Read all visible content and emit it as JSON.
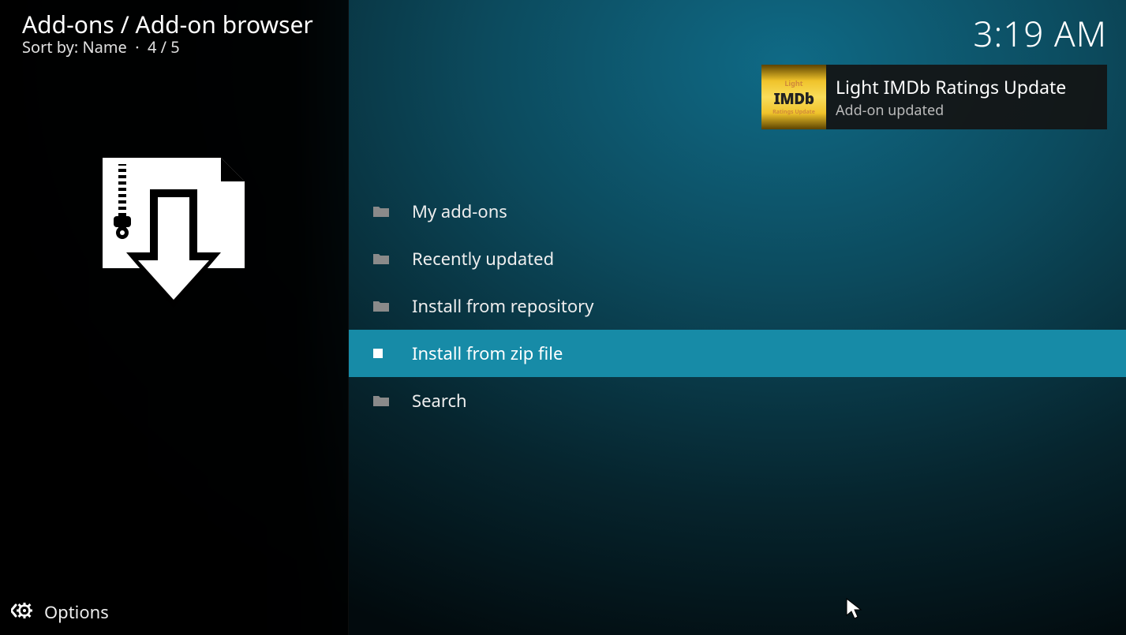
{
  "header": {
    "breadcrumb": "Add-ons / Add-on browser",
    "sort_label": "Sort by:",
    "sort_value": "Name",
    "position": "4 / 5",
    "clock": "3:19 AM"
  },
  "notification": {
    "title": "Light IMDb Ratings Update",
    "subtitle": "Add-on updated",
    "thumb_line1": "Light",
    "thumb_line2": "IMDb",
    "thumb_line3": "Ratings Update"
  },
  "menu": {
    "items": [
      {
        "label": "My add-ons",
        "icon": "folder",
        "selected": false
      },
      {
        "label": "Recently updated",
        "icon": "folder",
        "selected": false
      },
      {
        "label": "Install from repository",
        "icon": "folder",
        "selected": false
      },
      {
        "label": "Install from zip file",
        "icon": "file",
        "selected": true
      },
      {
        "label": "Search",
        "icon": "folder",
        "selected": false
      }
    ]
  },
  "footer": {
    "options_label": "Options"
  }
}
